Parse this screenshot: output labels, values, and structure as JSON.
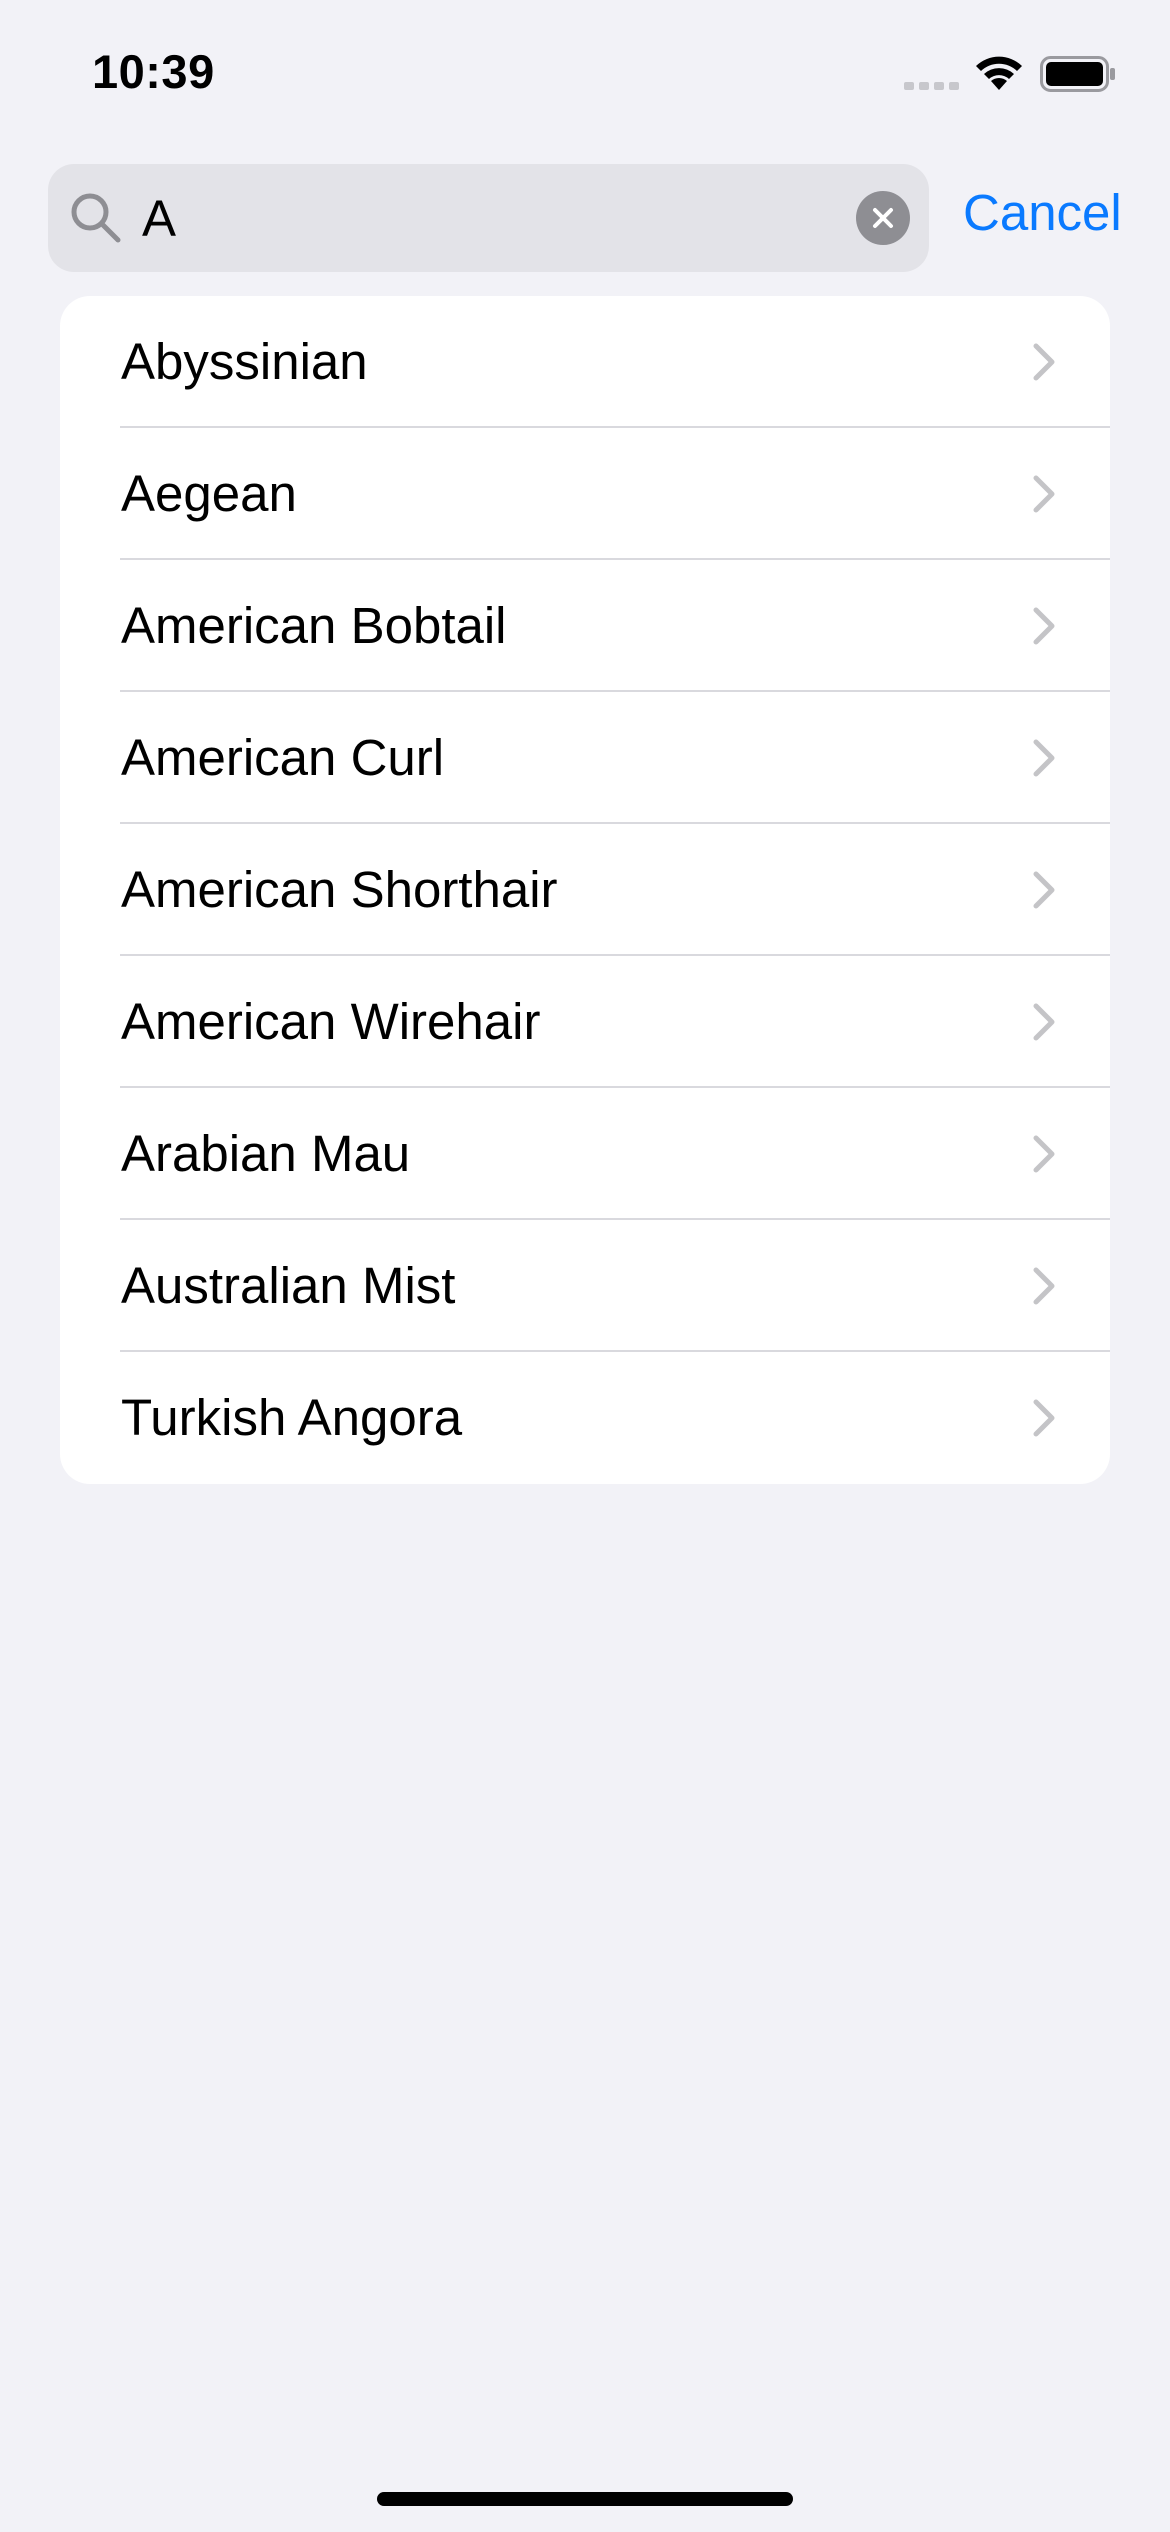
{
  "status_bar": {
    "time": "10:39",
    "icons": [
      "cellular-signal-icon",
      "wifi-icon",
      "battery-icon"
    ]
  },
  "search": {
    "value": "A",
    "placeholder": "Search",
    "cancel_label": "Cancel",
    "icons": {
      "search": "search-icon",
      "clear": "clear-circle-icon"
    }
  },
  "results": [
    {
      "label": "Abyssinian"
    },
    {
      "label": "Aegean"
    },
    {
      "label": "American Bobtail"
    },
    {
      "label": "American Curl"
    },
    {
      "label": "American Shorthair"
    },
    {
      "label": "American Wirehair"
    },
    {
      "label": "Arabian Mau"
    },
    {
      "label": "Australian Mist"
    },
    {
      "label": "Turkish Angora"
    }
  ],
  "colors": {
    "background": "#f2f2f7",
    "accent": "#0a7aff",
    "search_field": "#e3e3e8",
    "chevron": "#c4c4c7"
  }
}
